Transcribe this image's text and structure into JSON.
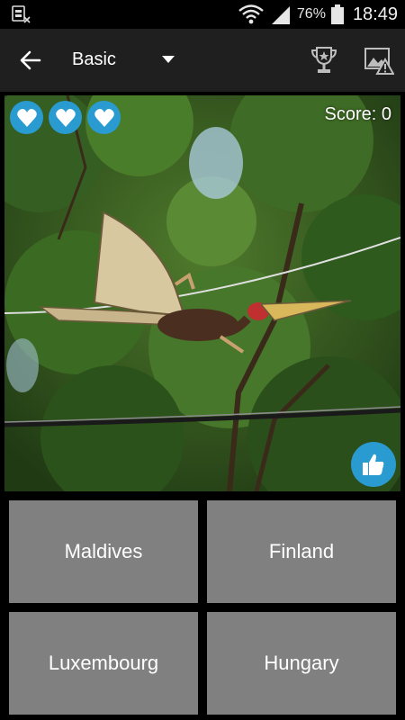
{
  "status_bar": {
    "battery_percent": "76%",
    "time": "18:49",
    "icons": [
      "sim-card-icon",
      "wifi-icon",
      "signal-icon",
      "battery-icon"
    ]
  },
  "app_bar": {
    "mode": "Basic",
    "icons": [
      "back-arrow-icon",
      "dropdown-caret-icon",
      "trophy-icon",
      "report-image-icon"
    ]
  },
  "game": {
    "lives": 3,
    "score_text": "Score: 0",
    "icons": [
      "heart-icon",
      "thumbs-up-icon"
    ]
  },
  "answers": [
    "Maldives",
    "Finland",
    "Luxembourg",
    "Hungary"
  ],
  "colors": {
    "accent": "#2a9bd1",
    "app_bar_bg": "#1f1f1f",
    "answer_bg": "#808080",
    "background": "#000000"
  }
}
